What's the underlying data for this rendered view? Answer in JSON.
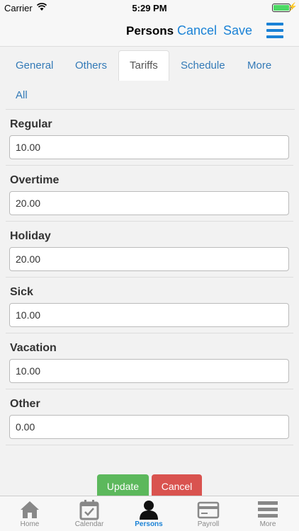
{
  "status": {
    "carrier": "Carrier",
    "time": "5:29 PM"
  },
  "navbar": {
    "title": "Persons",
    "cancel": "Cancel",
    "save": "Save"
  },
  "tabs": [
    "General",
    "Others",
    "Tariffs",
    "Schedule",
    "More",
    "All"
  ],
  "fields": [
    {
      "label": "Regular",
      "value": "10.00"
    },
    {
      "label": "Overtime",
      "value": "20.00"
    },
    {
      "label": "Holiday",
      "value": "20.00"
    },
    {
      "label": "Sick",
      "value": "10.00"
    },
    {
      "label": "Vacation",
      "value": "10.00"
    },
    {
      "label": "Other",
      "value": "0.00"
    }
  ],
  "buttons": {
    "update": "Update",
    "cancel": "Cancel"
  },
  "tabbar": [
    {
      "label": "Home",
      "icon": "home-icon"
    },
    {
      "label": "Calendar",
      "icon": "calendar-icon"
    },
    {
      "label": "Persons",
      "icon": "person-icon"
    },
    {
      "label": "Payroll",
      "icon": "credit-card-icon"
    },
    {
      "label": "More",
      "icon": "menu-icon"
    }
  ],
  "colors": {
    "accent": "#1a82d6",
    "update": "#5cb85c",
    "cancel": "#d9534f"
  }
}
